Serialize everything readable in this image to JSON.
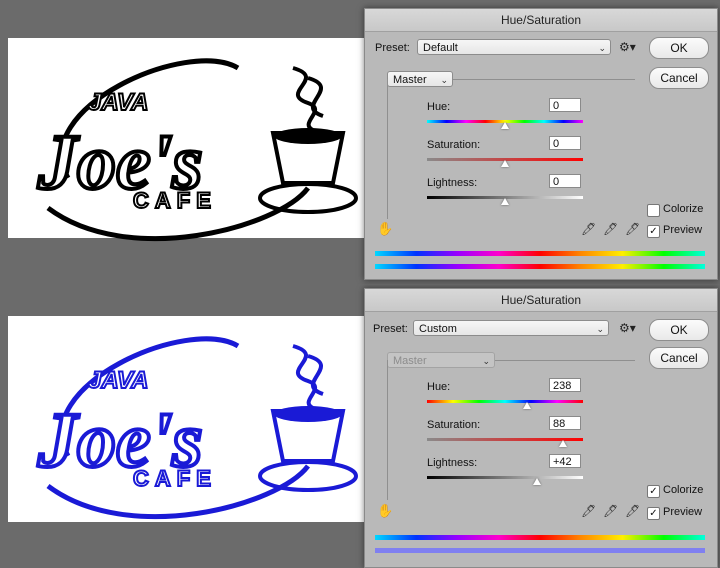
{
  "logo": {
    "line1": "JAVA",
    "line2": "Joe's",
    "line3": "CAFE",
    "color_original": "#000000",
    "color_colorized": "#1a1ad6"
  },
  "dialog_top": {
    "title": "Hue/Saturation",
    "preset_label": "Preset:",
    "preset_value": "Default",
    "ok": "OK",
    "cancel": "Cancel",
    "channel": "Master",
    "hue_label": "Hue:",
    "hue_value": "0",
    "sat_label": "Saturation:",
    "sat_value": "0",
    "light_label": "Lightness:",
    "light_value": "0",
    "colorize_label": "Colorize",
    "colorize_checked": false,
    "preview_label": "Preview",
    "preview_checked": true
  },
  "dialog_bottom": {
    "title": "Hue/Saturation",
    "preset_label": "Preset:",
    "preset_value": "Custom",
    "ok": "OK",
    "cancel": "Cancel",
    "channel": "Master",
    "hue_label": "Hue:",
    "hue_value": "238",
    "sat_label": "Saturation:",
    "sat_value": "88",
    "light_label": "Lightness:",
    "light_value": "+42",
    "colorize_label": "Colorize",
    "colorize_checked": true,
    "preview_label": "Preview",
    "preview_checked": true,
    "result_bar_color": "#8080f0"
  },
  "icons": {
    "gear": "gear-icon",
    "hand": "hand-icon",
    "eyedropper": "eyedropper-icon",
    "checkmark": "✓"
  }
}
